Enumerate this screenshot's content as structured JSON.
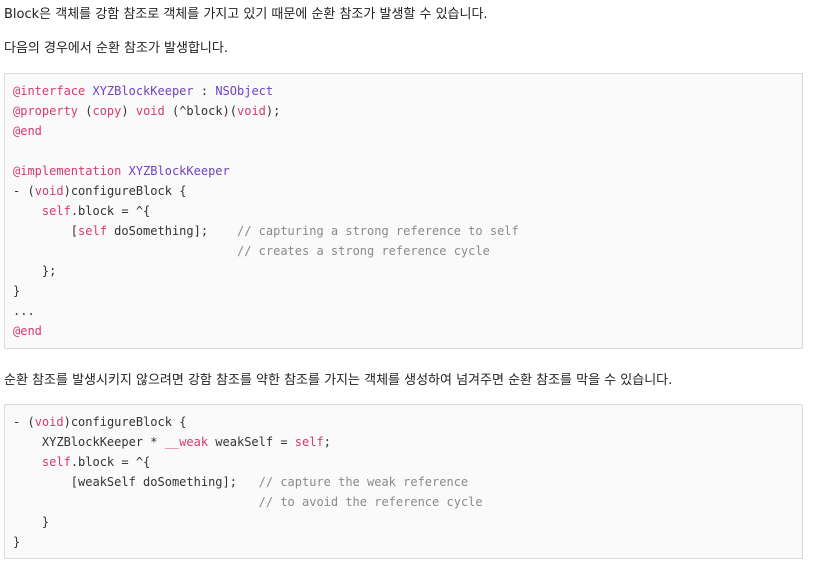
{
  "paragraphs": {
    "intro": "Block은 객체를 강함 참조로 객체를 가지고 있기 때문에 순환 참조가 발생할 수 있습니다.",
    "case": "다음의 경우에서 순환 참조가 발생합니다.",
    "fix": "순환 참조를 발생시키지 않으려면 강함 참조를 약한 참조를 가지는 객체를 생성하여 넘겨주면 순환 참조를 막을 수 있습니다."
  },
  "code1": [
    [
      {
        "t": "@interface",
        "c": "kw"
      },
      {
        "t": " "
      },
      {
        "t": "XYZBlockKeeper",
        "c": "cls"
      },
      {
        "t": " : "
      },
      {
        "t": "NSObject",
        "c": "cls"
      }
    ],
    [
      {
        "t": "@property",
        "c": "kw"
      },
      {
        "t": " ("
      },
      {
        "t": "copy",
        "c": "kw"
      },
      {
        "t": ") "
      },
      {
        "t": "void",
        "c": "kw"
      },
      {
        "t": " (^block)("
      },
      {
        "t": "void",
        "c": "kw"
      },
      {
        "t": ");"
      }
    ],
    [
      {
        "t": "@end",
        "c": "kw"
      }
    ],
    [],
    [
      {
        "t": "@implementation",
        "c": "kw"
      },
      {
        "t": " "
      },
      {
        "t": "XYZBlockKeeper",
        "c": "cls"
      }
    ],
    [
      {
        "t": "- ("
      },
      {
        "t": "void",
        "c": "kw"
      },
      {
        "t": ")configureBlock {"
      }
    ],
    [
      {
        "t": "    "
      },
      {
        "t": "self",
        "c": "kw"
      },
      {
        "t": ".block = ^{"
      }
    ],
    [
      {
        "t": "        ["
      },
      {
        "t": "self",
        "c": "kw"
      },
      {
        "t": " doSomething];    "
      },
      {
        "t": "// capturing a strong reference to self",
        "c": "cm"
      }
    ],
    [
      {
        "t": "                               "
      },
      {
        "t": "// creates a strong reference cycle",
        "c": "cm"
      }
    ],
    [
      {
        "t": "    };"
      }
    ],
    [
      {
        "t": "}"
      }
    ],
    [
      {
        "t": "..."
      }
    ],
    [
      {
        "t": "@end",
        "c": "kw"
      }
    ]
  ],
  "code2": [
    [
      {
        "t": "- ("
      },
      {
        "t": "void",
        "c": "kw"
      },
      {
        "t": ")configureBlock {"
      }
    ],
    [
      {
        "t": "    XYZBlockKeeper * "
      },
      {
        "t": "__weak",
        "c": "kw"
      },
      {
        "t": " weakSelf = "
      },
      {
        "t": "self",
        "c": "kw"
      },
      {
        "t": ";"
      }
    ],
    [
      {
        "t": "    "
      },
      {
        "t": "self",
        "c": "kw"
      },
      {
        "t": ".block = ^{"
      }
    ],
    [
      {
        "t": "        [weakSelf doSomething];   "
      },
      {
        "t": "// capture the weak reference",
        "c": "cm"
      }
    ],
    [
      {
        "t": "                                  "
      },
      {
        "t": "// to avoid the reference cycle",
        "c": "cm"
      }
    ],
    [
      {
        "t": "    }"
      }
    ],
    [
      {
        "t": "}"
      }
    ]
  ]
}
